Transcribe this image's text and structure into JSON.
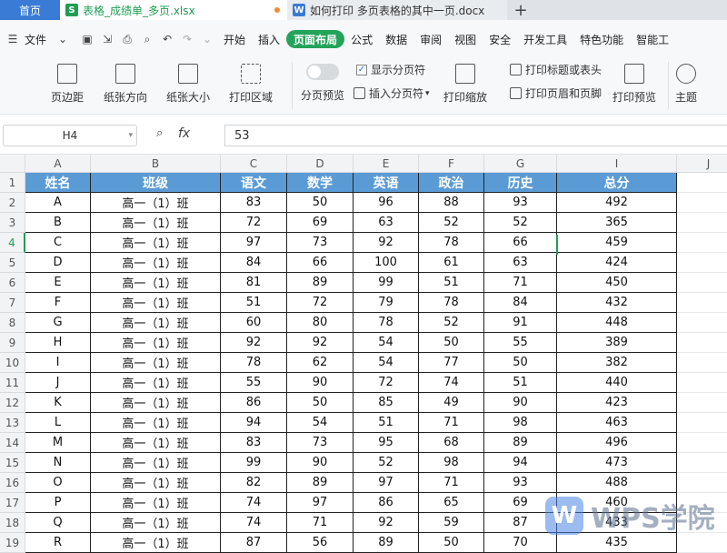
{
  "tabs": {
    "home": "首页",
    "active_file": "表格_成绩单_多页.xlsx",
    "doc_file": "如何打印 多页表格的其中一页.docx",
    "new_tab": "+"
  },
  "menu": {
    "file": "文件",
    "items": [
      "开始",
      "插入",
      "页面布局",
      "公式",
      "数据",
      "审阅",
      "视图",
      "安全",
      "开发工具",
      "特色功能",
      "智能工"
    ]
  },
  "ribbon": {
    "margins": "页边距",
    "orientation": "纸张方向",
    "size": "纸张大小",
    "print_area": "打印区域",
    "page_break_preview": "分页预览",
    "show_page_breaks": "显示分页符",
    "insert_page_break": "插入分页符",
    "print_scaling": "打印缩放",
    "print_titles": "打印标题或表头",
    "header_footer": "打印页眉和页脚",
    "print_preview": "打印预览",
    "theme": "主题"
  },
  "formula_bar": {
    "cell_ref": "H4",
    "fx": "fx",
    "value": "53"
  },
  "sheet": {
    "columns": [
      "A",
      "B",
      "C",
      "D",
      "E",
      "F",
      "G",
      "I",
      "J"
    ],
    "row_numbers": [
      "1",
      "2",
      "3",
      "4",
      "5",
      "6",
      "7",
      "8",
      "9",
      "10",
      "11",
      "12",
      "13",
      "14",
      "15",
      "16",
      "17",
      "18",
      "19"
    ],
    "headers": [
      "姓名",
      "班级",
      "语文",
      "数学",
      "英语",
      "政治",
      "历史",
      "总分"
    ],
    "rows": [
      [
        "A",
        "高一（1）班",
        "83",
        "50",
        "96",
        "88",
        "93",
        "492"
      ],
      [
        "B",
        "高一（1）班",
        "72",
        "69",
        "63",
        "52",
        "52",
        "365"
      ],
      [
        "C",
        "高一（1）班",
        "97",
        "73",
        "92",
        "78",
        "66",
        "459"
      ],
      [
        "D",
        "高一（1）班",
        "84",
        "66",
        "100",
        "61",
        "63",
        "424"
      ],
      [
        "E",
        "高一（1）班",
        "81",
        "89",
        "99",
        "51",
        "71",
        "450"
      ],
      [
        "F",
        "高一（1）班",
        "51",
        "72",
        "79",
        "78",
        "84",
        "432"
      ],
      [
        "G",
        "高一（1）班",
        "60",
        "80",
        "78",
        "52",
        "91",
        "448"
      ],
      [
        "H",
        "高一（1）班",
        "92",
        "92",
        "54",
        "50",
        "55",
        "389"
      ],
      [
        "I",
        "高一（1）班",
        "78",
        "62",
        "54",
        "77",
        "50",
        "382"
      ],
      [
        "J",
        "高一（1）班",
        "55",
        "90",
        "72",
        "74",
        "51",
        "440"
      ],
      [
        "K",
        "高一（1）班",
        "86",
        "50",
        "85",
        "49",
        "90",
        "423"
      ],
      [
        "L",
        "高一（1）班",
        "94",
        "54",
        "51",
        "71",
        "98",
        "463"
      ],
      [
        "M",
        "高一（1）班",
        "83",
        "73",
        "95",
        "68",
        "89",
        "496"
      ],
      [
        "N",
        "高一（1）班",
        "99",
        "90",
        "52",
        "98",
        "94",
        "473"
      ],
      [
        "O",
        "高一（1）班",
        "82",
        "89",
        "97",
        "71",
        "93",
        "488"
      ],
      [
        "P",
        "高一（1）班",
        "74",
        "97",
        "86",
        "65",
        "69",
        "460"
      ],
      [
        "Q",
        "高一（1）班",
        "74",
        "71",
        "92",
        "59",
        "87",
        "433"
      ],
      [
        "R",
        "高一（1）班",
        "87",
        "56",
        "89",
        "50",
        "70",
        "435"
      ]
    ],
    "selected_row": "4"
  },
  "watermark": {
    "logo": "W",
    "text": "WPS学院"
  }
}
